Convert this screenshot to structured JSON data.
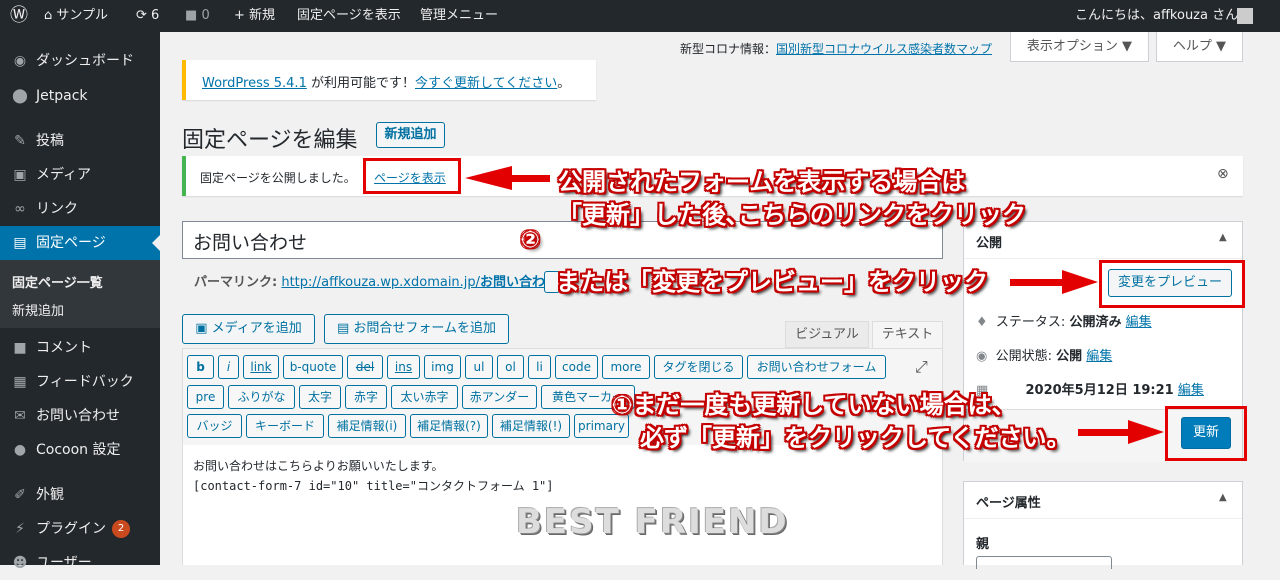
{
  "admin_bar": {
    "site_name": "サンプル",
    "updates_count": "6",
    "comments_count": "0",
    "new_label": "新規",
    "view_page": "固定ページを表示",
    "admin_menu": "管理メニュー",
    "greeting": "こんにちは、affkouza さん"
  },
  "sidebar": {
    "items": [
      {
        "label": "ダッシュボード",
        "icon": "dashboard-icon"
      },
      {
        "label": "Jetpack",
        "icon": "jetpack-icon"
      },
      {
        "label": "投稿",
        "icon": "pin-icon"
      },
      {
        "label": "メディア",
        "icon": "media-icon"
      },
      {
        "label": "リンク",
        "icon": "link-icon"
      },
      {
        "label": "固定ページ",
        "icon": "pages-icon"
      },
      {
        "label": "コメント",
        "icon": "comment-icon"
      },
      {
        "label": "フィードバック",
        "icon": "feedback-icon"
      },
      {
        "label": "お問い合わせ",
        "icon": "mail-icon"
      },
      {
        "label": "Cocoon 設定",
        "icon": "cocoon-icon"
      },
      {
        "label": "外観",
        "icon": "brush-icon"
      },
      {
        "label": "プラグイン",
        "icon": "plugin-icon"
      },
      {
        "label": "ユーザー",
        "icon": "user-icon"
      }
    ],
    "submenu": [
      "固定ページ一覧",
      "新規追加"
    ],
    "plugins_badge": "2"
  },
  "top_right": {
    "corona_label": "新型コロナ情報：",
    "corona_link": "国別新型コロナウイルス感染者数マップ",
    "screen_options": "表示オプション ▼",
    "help": "ヘルプ ▼"
  },
  "update_notice": {
    "version_link": "WordPress 5.4.1",
    "middle_text": " が利用可能です！",
    "update_link": "今すぐ更新してください",
    "end": "。"
  },
  "page_heading": {
    "title": "固定ページを編集",
    "add_new": "新規追加"
  },
  "published_notice": {
    "text": "固定ページを公開しました。",
    "view_link": "ページを表示"
  },
  "editor": {
    "title_value": "お問い合わせ",
    "permalink_label": "パーマリンク:",
    "permalink_base": "http://affkouza.wp.xdomain.jp/",
    "permalink_slug": "お問い合わせ",
    "permalink_end": "/",
    "add_media": "メディアを追加",
    "add_contact_form": "お問合せフォームを追加",
    "tab_visual": "ビジュアル",
    "tab_text": "テキスト",
    "qt_row1": [
      "b",
      "i",
      "link",
      "b-quote",
      "del",
      "ins",
      "img",
      "ul",
      "ol",
      "li",
      "code",
      "more",
      "タグを閉じる",
      "お問い合わせフォーム"
    ],
    "qt_row2": [
      "pre",
      "ふりがな",
      "太字",
      "赤字",
      "太い赤字",
      "赤アンダー",
      "黄色マーカー"
    ],
    "qt_row3": [
      "バッジ",
      "キーボード",
      "補足情報(i)",
      "補足情報(?)",
      "補足情報(!)",
      "primary"
    ],
    "content_line1": "お問い合わせはこちらよりお願いいたします。",
    "content_line2": "[contact-form-7 id=\"10\" title=\"コンタクトフォーム 1\"]"
  },
  "publish_box": {
    "title": "公開",
    "preview_button": "変更をプレビュー",
    "status_label": "ステータス: ",
    "status_value": "公開済み",
    "status_edit": "編集",
    "visibility_label": "公開状態: ",
    "visibility_value": "公開",
    "visibility_edit": "編集",
    "date_value": "2020年5月12日 19:21",
    "date_edit": "編集",
    "update_button": "更新"
  },
  "attributes_box": {
    "title": "ページ属性",
    "parent_label": "親"
  },
  "annotations": {
    "a1_line1": "公開されたフォームを表示する場合は",
    "a1_line2": "「更新」した後､こちらのリンクをクリック",
    "marker2": "②",
    "a2": "または「変更をプレビュー」をクリック",
    "a3_line1": "①まだ一度も更新していない場合は、",
    "a3_line2": "必ず「更新」をクリックしてください。",
    "watermark": "BEST FRIEND"
  },
  "colors": {
    "admin_bg": "#23282d",
    "accent": "#0073aa",
    "annotation_red": "#e20000"
  }
}
